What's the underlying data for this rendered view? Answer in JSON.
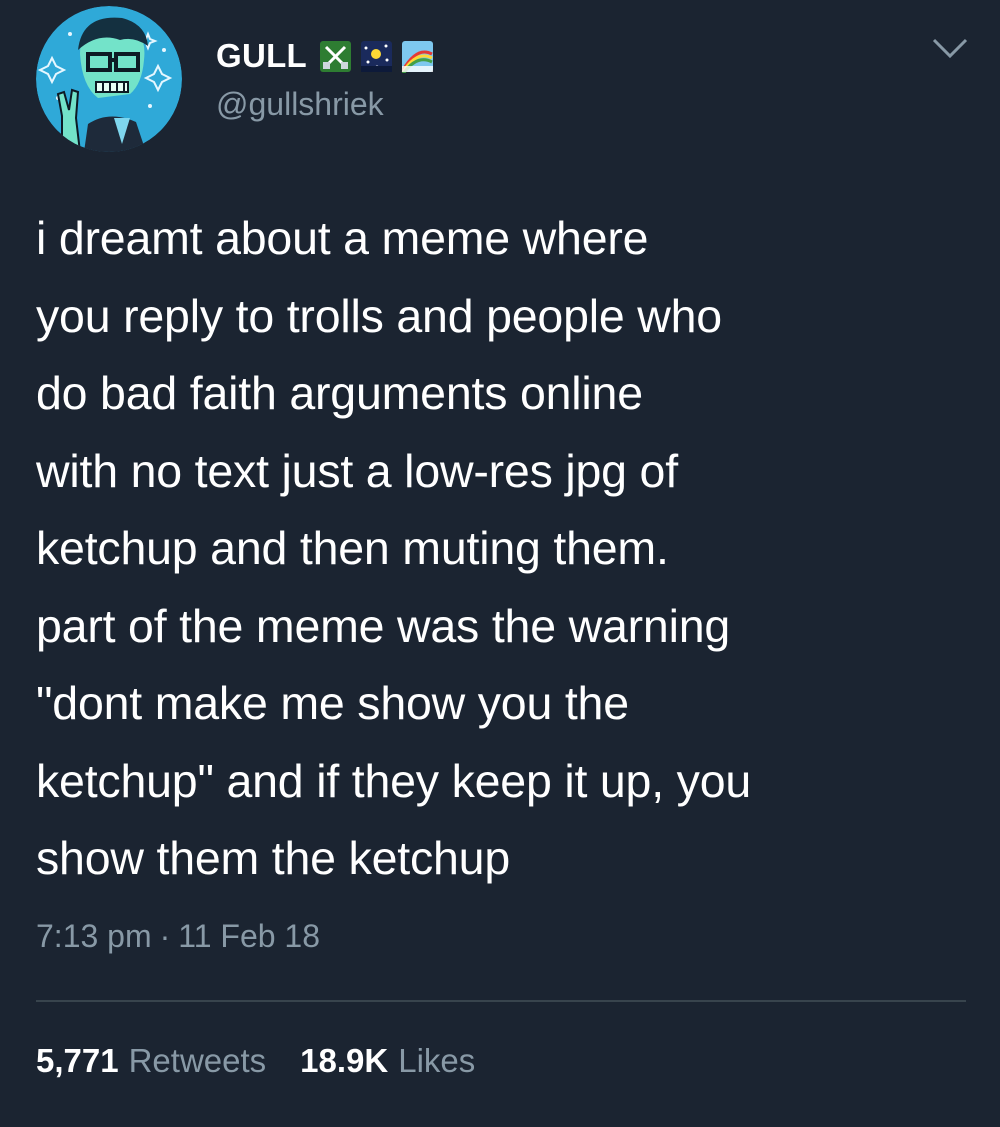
{
  "author": {
    "display_name": "GULL",
    "handle": "@gullshriek",
    "avatar_icon": "skeleton-with-glasses-avatar",
    "badges": [
      "crossed-swords-emoji",
      "night-sky-emoji",
      "rainbow-emoji"
    ]
  },
  "tweet": {
    "text": "i dreamt about a meme where\nyou reply to trolls and people who\ndo bad faith arguments online\nwith no text just a low-res jpg of\nketchup and then muting them.\npart of the meme was the warning\n\"dont make me show you the\nketchup\" and if they keep it up, you\nshow them the ketchup",
    "time": "7:13 pm",
    "separator": "·",
    "date": "11 Feb 18"
  },
  "stats": {
    "retweets_count": "5,771",
    "retweets_label": "Retweets",
    "likes_count": "18.9K",
    "likes_label": "Likes"
  },
  "menu": {
    "icon": "chevron-down-icon"
  },
  "colors": {
    "background": "#1b2431",
    "text": "#ffffff",
    "secondary_text": "#8899a6",
    "divider": "#38444d",
    "avatar_bg": "#2fa9d8"
  }
}
